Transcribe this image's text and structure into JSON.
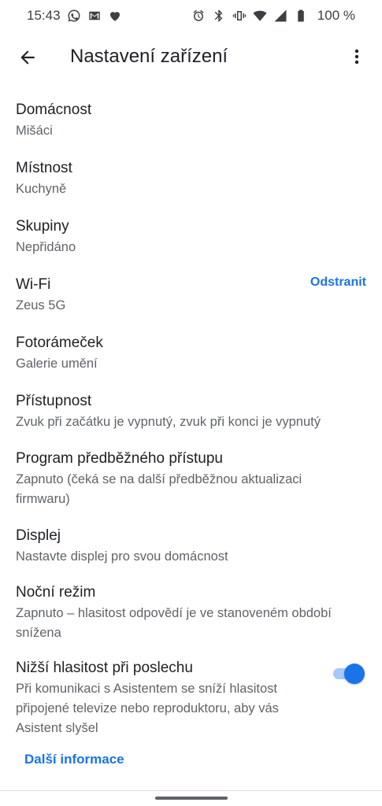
{
  "status_bar": {
    "time": "15:43",
    "battery_text": "100 %",
    "left_icons": [
      "whatsapp-icon",
      "gmail-icon",
      "health-icon"
    ],
    "right_icons": [
      "alarm-icon",
      "bluetooth-icon",
      "vibrate-icon",
      "wifi-icon",
      "signal-icon",
      "battery-icon"
    ]
  },
  "app_bar": {
    "title": "Nastavení zařízení",
    "back_icon": "arrow-back-icon",
    "menu_icon": "more-vert-icon"
  },
  "settings": [
    {
      "title": "Domácnost",
      "subtitle": "Mišáci"
    },
    {
      "title": "Místnost",
      "subtitle": "Kuchyně"
    },
    {
      "title": "Skupiny",
      "subtitle": "Nepřidáno"
    },
    {
      "title": "Wi-Fi",
      "subtitle": "Zeus 5G",
      "action": "Odstranit"
    },
    {
      "title": "Fotorámeček",
      "subtitle": "Galerie umění"
    },
    {
      "title": "Přístupnost",
      "subtitle": "Zvuk při začátku je vypnutý, zvuk při konci je vypnutý"
    },
    {
      "title": "Program předběžného přístupu",
      "subtitle_lines": [
        "Zapnuto (čeká se na další předběžnou aktualizaci",
        "firmwaru)"
      ]
    },
    {
      "title": "Displej",
      "subtitle": "Nastavte displej pro svou domácnost"
    },
    {
      "title": "Noční režim",
      "subtitle_lines": [
        "Zapnuto – hlasitost odpovědí je ve stanoveném období",
        "snížena"
      ]
    },
    {
      "title": "Nižší hlasitost při poslechu",
      "subtitle_lines": [
        "Při komunikaci s Asistentem se sníží hlasitost",
        "připojené televize nebo reproduktoru, aby vás",
        "Asistent slyšel"
      ],
      "toggle_on": true
    }
  ],
  "more_info": "Další informace",
  "colors": {
    "accent": "#1a73e8",
    "toggle_track": "#a8c7fa",
    "text_primary": "#202124",
    "text_secondary": "#5f6368"
  }
}
